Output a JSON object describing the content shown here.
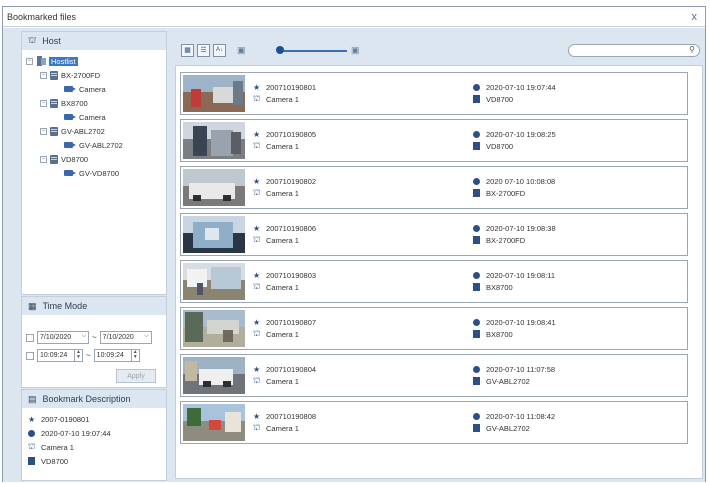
{
  "window": {
    "title": "Bookmarked files",
    "close_label": "x"
  },
  "host_panel": {
    "title": "Host",
    "tree": [
      {
        "label": "Hostlist",
        "level": 0,
        "kind": "hostlist",
        "toggle": "⊟"
      },
      {
        "label": "BX-2700FD",
        "level": 1,
        "kind": "server",
        "toggle": "⊟"
      },
      {
        "label": "Camera",
        "level": 2,
        "kind": "camera"
      },
      {
        "label": "BX8700",
        "level": 1,
        "kind": "server",
        "toggle": "⊟"
      },
      {
        "label": "Camera",
        "level": 2,
        "kind": "camera"
      },
      {
        "label": "GV-ABL2702",
        "level": 1,
        "kind": "server",
        "toggle": "⊟"
      },
      {
        "label": "GV-ABL2702",
        "level": 2,
        "kind": "camera"
      },
      {
        "label": "VD8700",
        "level": 1,
        "kind": "server",
        "toggle": "⊟"
      },
      {
        "label": "GV-VD8700",
        "level": 2,
        "kind": "camera"
      }
    ]
  },
  "time_panel": {
    "title": "Time Mode",
    "start_date": "7/10/2020",
    "end_date": "7/10/2020",
    "start_time": "10:09:24",
    "end_time": "10:09:24",
    "separator": "~",
    "apply_label": "Apply"
  },
  "desc_panel": {
    "title": "Bookmark Description",
    "id": "2007-0190801",
    "datetime": "2020-07-10 19:07:44",
    "camera": "Camera 1",
    "server": "VD8700"
  },
  "toolbar": {
    "view_grid": "▦",
    "view_list": "☰",
    "sort": "A↓",
    "zoom_out": "▣",
    "zoom_in": "▣",
    "zoom_level": 0.1,
    "search_placeholder": "",
    "search_icon": "⚲"
  },
  "bookmarks": [
    {
      "id": "200710190801",
      "camera": "Camera 1",
      "datetime": "2020-07-10 19:07:44",
      "server": "VD8700"
    },
    {
      "id": "200710190805",
      "camera": "Camera 1",
      "datetime": "2020-07-10 19:08:25",
      "server": "VD8700"
    },
    {
      "id": "200710190802",
      "camera": "Camera 1",
      "datetime": "2020 07-10 10:08:08",
      "server": "BX-2700FD"
    },
    {
      "id": "200710190806",
      "camera": "Camera 1",
      "datetime": "2020-07-10 19:08:38",
      "server": "BX-2700FD"
    },
    {
      "id": "200710190803",
      "camera": "Camera 1",
      "datetime": "2020-07-10 19:08:11",
      "server": "BX8700"
    },
    {
      "id": "200710190807",
      "camera": "Camera 1",
      "datetime": "2020-07-10 19:08:41",
      "server": "BX8700"
    },
    {
      "id": "200710190804",
      "camera": "Camera 1",
      "datetime": "2020-07-10 11:07:58",
      "server": "GV-ABL2702"
    },
    {
      "id": "200710190808",
      "camera": "Camera 1",
      "datetime": "2020-07-10 11:08:42",
      "server": "GV-ABL2702"
    }
  ],
  "icons": {
    "star": "★",
    "camera": "⌂",
    "clock": "●",
    "server": "▤"
  },
  "colors": {
    "accent": "#3c78c8",
    "icon": "#2d4f86",
    "panel_bg": "#dbe6f1"
  }
}
